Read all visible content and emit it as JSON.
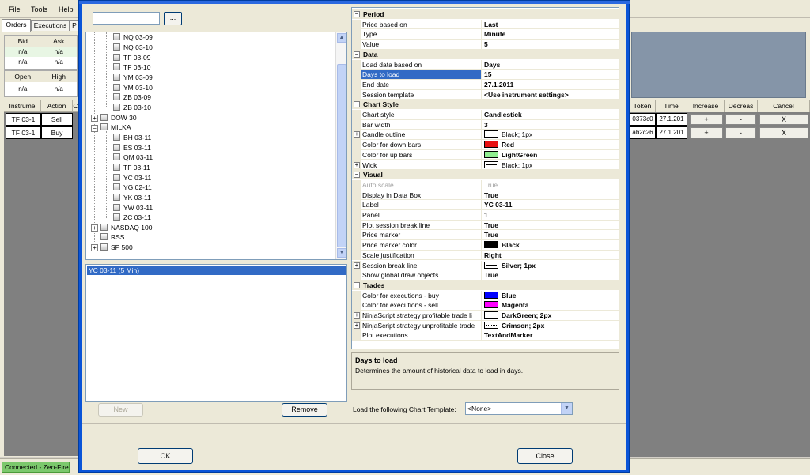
{
  "menu": {
    "file": "File",
    "tools": "Tools",
    "help": "Help"
  },
  "tabs": {
    "orders": "Orders",
    "executions": "Executions",
    "positions": "P"
  },
  "quote_top": {
    "headers": [
      "Bid",
      "Ask"
    ],
    "rows": [
      [
        "n/a",
        "n/a"
      ],
      [
        "n/a",
        "n/a"
      ]
    ]
  },
  "quote_bottom": {
    "headers": [
      "Open",
      "High"
    ],
    "rows": [
      [
        "n/a",
        "n/a"
      ]
    ]
  },
  "orders_grid": {
    "headers": [
      "Instrume",
      "Action",
      "C"
    ],
    "rows": [
      [
        "TF 03-1",
        "Sell"
      ],
      [
        "TF 03-1",
        "Buy"
      ]
    ]
  },
  "right_grid": {
    "headers": [
      "Token",
      "Time",
      "Increase",
      "Decreas",
      "Cancel"
    ],
    "rows": [
      {
        "token": "0373c0",
        "time": "27.1.201",
        "inc": "+",
        "dec": "-",
        "cancel": "X"
      },
      {
        "token": "ab2c26",
        "time": "27.1.201",
        "inc": "+",
        "dec": "-",
        "cancel": "X"
      }
    ]
  },
  "status": {
    "connection": "Connected - Zen-Fire"
  },
  "dialog": {
    "filter_value": "",
    "filter_button": "...",
    "tree": {
      "items_a": [
        "NQ 03-09",
        "NQ 03-10",
        "TF 03-09",
        "TF 03-10",
        "YM 03-09",
        "YM 03-10",
        "ZB 03-09",
        "ZB 03-10"
      ],
      "dow": "DOW 30",
      "milka": "MILKA",
      "items_b": [
        "BH 03-11",
        "ES 03-11",
        "QM 03-11",
        "TF 03-11",
        "YC 03-11",
        "YG 02-11",
        "YK 03-11",
        "YW 03-11",
        "ZC 03-11"
      ],
      "nasdaq": "NASDAQ 100",
      "rss": "RSS",
      "sp": "SP 500"
    },
    "series_selected": "YC 03-11 (5 Min)",
    "new_button": "New",
    "remove_button": "Remove",
    "ok_button": "OK",
    "close_button": "Close",
    "template_label": "Load the following Chart Template:",
    "template_value": "<None>",
    "help": {
      "title": "Days to load",
      "text": "Determines the amount of historical data to load in days."
    },
    "props": {
      "period": {
        "title": "Period",
        "price_based_on": {
          "name": "Price based on",
          "value": "Last"
        },
        "type": {
          "name": "Type",
          "value": "Minute"
        },
        "value": {
          "name": "Value",
          "value": "5"
        }
      },
      "data": {
        "title": "Data",
        "load_based_on": {
          "name": "Load data based on",
          "value": "Days"
        },
        "days_to_load": {
          "name": "Days to load",
          "value": "15"
        },
        "end_date": {
          "name": "End date",
          "value": "27.1.2011"
        },
        "session_template": {
          "name": "Session template",
          "value": "<Use instrument settings>"
        }
      },
      "chart_style": {
        "title": "Chart Style",
        "chart_style": {
          "name": "Chart style",
          "value": "Candlestick"
        },
        "bar_width": {
          "name": "Bar width",
          "value": "3"
        },
        "candle_outline": {
          "name": "Candle outline",
          "value": "Black; 1px"
        },
        "down_bars": {
          "name": "Color for down bars",
          "value": "Red",
          "color": "#e81010"
        },
        "up_bars": {
          "name": "Color for up bars",
          "value": "LightGreen",
          "color": "#90ee90"
        },
        "wick": {
          "name": "Wick",
          "value": "Black; 1px"
        }
      },
      "visual": {
        "title": "Visual",
        "auto_scale": {
          "name": "Auto scale",
          "value": "True"
        },
        "display_data_box": {
          "name": "Display in Data Box",
          "value": "True"
        },
        "label": {
          "name": "Label",
          "value": "YC 03-11"
        },
        "panel": {
          "name": "Panel",
          "value": "1"
        },
        "plot_session_break": {
          "name": "Plot session break line",
          "value": "True"
        },
        "price_marker": {
          "name": "Price marker",
          "value": "True"
        },
        "price_marker_color": {
          "name": "Price marker color",
          "value": "Black",
          "color": "#000000"
        },
        "scale_justification": {
          "name": "Scale justification",
          "value": "Right"
        },
        "session_break_line": {
          "name": "Session break line",
          "value": "Silver; 1px"
        },
        "show_global_draw": {
          "name": "Show global draw objects",
          "value": "True"
        }
      },
      "trades": {
        "title": "Trades",
        "exec_buy": {
          "name": "Color for executions - buy",
          "value": "Blue",
          "color": "#0000ff"
        },
        "exec_sell": {
          "name": "Color for executions - sell",
          "value": "Magenta",
          "color": "#ff00ff"
        },
        "profitable": {
          "name": "NinjaScript strategy profitable trade li",
          "value": "DarkGreen; 2px"
        },
        "unprofitable": {
          "name": "NinjaScript strategy unprofitable trade",
          "value": "Crimson; 2px"
        },
        "plot_exec": {
          "name": "Plot executions",
          "value": "TextAndMarker"
        }
      }
    }
  }
}
